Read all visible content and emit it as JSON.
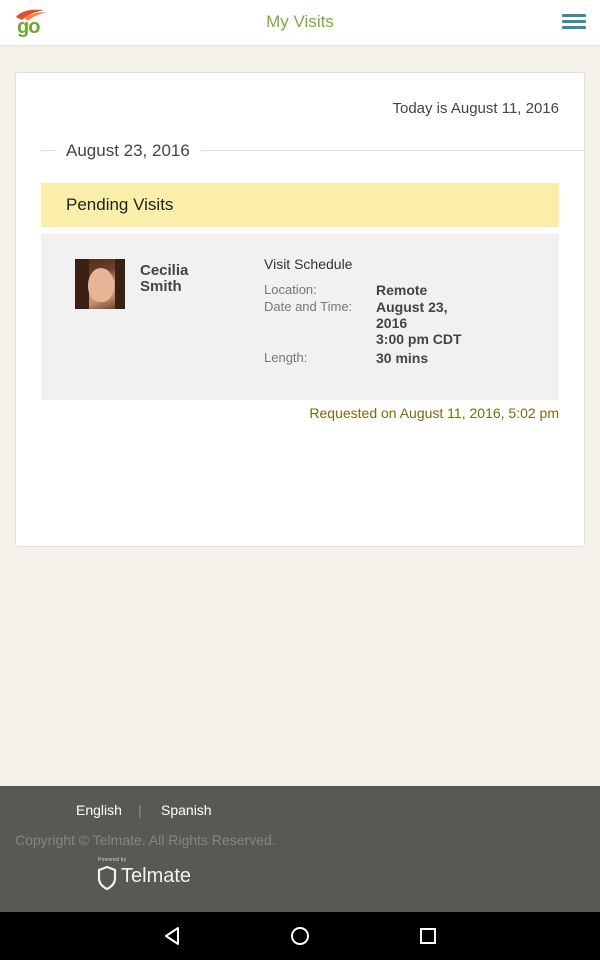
{
  "app": {
    "logo_text": "go",
    "title": "My Visits"
  },
  "card": {
    "today": "Today is August 11, 2016",
    "date_heading": "August 23, 2016",
    "pending_title": "Pending Visits",
    "visit": {
      "first_name": "Cecilia",
      "last_name": "Smith",
      "schedule_title": "Visit Schedule",
      "location_label": "Location:",
      "location_value": "Remote",
      "datetime_label": "Date and Time:",
      "date_line1": "August 23,",
      "date_line2": "2016",
      "time_value": "3:00 pm CDT",
      "length_label": "Length:",
      "length_value": "30 mins"
    },
    "requested": "Requested on August 11, 2016, 5:02 pm"
  },
  "footer": {
    "english": "English",
    "separator": "|",
    "spanish": "Spanish",
    "copyright": "Copyright © Telmate. All Rights Reserved.",
    "powered_by": "Powered by",
    "brand": "Telmate"
  },
  "icons": {
    "menu": "hamburger-menu-icon",
    "back": "back-triangle-icon",
    "home": "home-circle-icon",
    "recents": "recents-square-icon"
  },
  "colors": {
    "accent_green": "#7cab3f",
    "menu_teal": "#3a8a9e",
    "pending_yellow": "#fbeea8",
    "requested_text": "#7a6a08",
    "footer_bg": "#595852"
  }
}
